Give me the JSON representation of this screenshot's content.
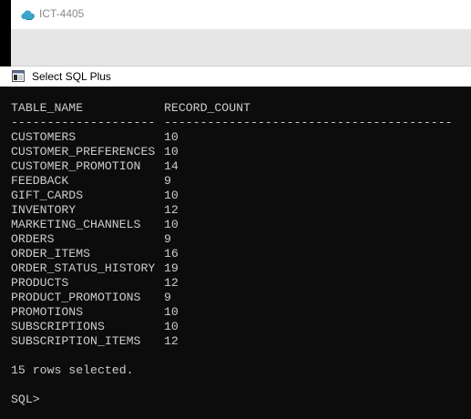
{
  "titlebar": {
    "app_icon": "cloud-icon",
    "title": "ICT-4405"
  },
  "window": {
    "icon": "console-window-icon",
    "title": "Select SQL Plus"
  },
  "result": {
    "columns": [
      "TABLE_NAME",
      "RECORD_COUNT"
    ],
    "underline": [
      "--------------------",
      "----------------------------------------"
    ],
    "rows": [
      {
        "table_name": "CUSTOMERS",
        "record_count": "10"
      },
      {
        "table_name": "CUSTOMER_PREFERENCES",
        "record_count": "10"
      },
      {
        "table_name": "CUSTOMER_PROMOTION",
        "record_count": "14"
      },
      {
        "table_name": "FEEDBACK",
        "record_count": "9"
      },
      {
        "table_name": "GIFT_CARDS",
        "record_count": "10"
      },
      {
        "table_name": "INVENTORY",
        "record_count": "12"
      },
      {
        "table_name": "MARKETING_CHANNELS",
        "record_count": "10"
      },
      {
        "table_name": "ORDERS",
        "record_count": "9"
      },
      {
        "table_name": "ORDER_ITEMS",
        "record_count": "16"
      },
      {
        "table_name": "ORDER_STATUS_HISTORY",
        "record_count": "19"
      },
      {
        "table_name": "PRODUCTS",
        "record_count": "12"
      },
      {
        "table_name": "PRODUCT_PROMOTIONS",
        "record_count": "9"
      },
      {
        "table_name": "PROMOTIONS",
        "record_count": "10"
      },
      {
        "table_name": "SUBSCRIPTIONS",
        "record_count": "10"
      },
      {
        "table_name": "SUBSCRIPTION_ITEMS",
        "record_count": "12"
      }
    ],
    "footer": "15 rows selected."
  },
  "prompt": "SQL>",
  "colors": {
    "console_bg": "#0c0c0c",
    "console_text": "#cccccc",
    "titlebar_bg": "#ffffff",
    "band_bg": "#e6e6e6",
    "cloud_accent": "#3aa5c8"
  }
}
